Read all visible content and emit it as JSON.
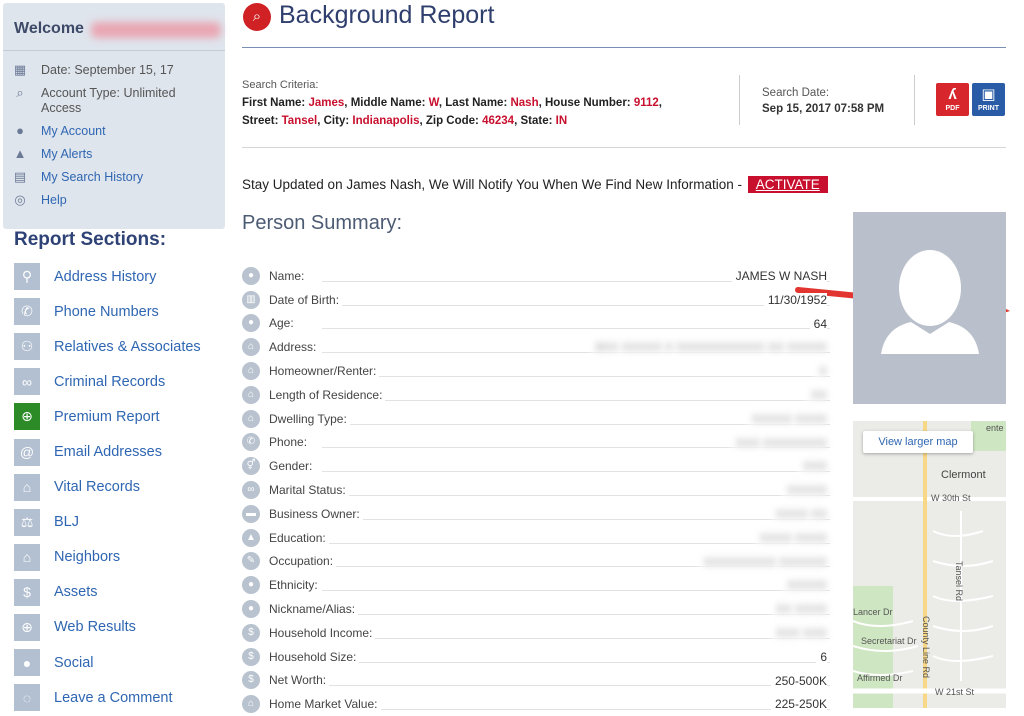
{
  "sidebar": {
    "welcome": "Welcome",
    "account": [
      {
        "icon": "calendar-icon",
        "glyph": "▦",
        "text": "Date: September 15, 17",
        "link": false
      },
      {
        "icon": "search-icon",
        "glyph": "⌕",
        "text": "Account Type: Unlimited Access",
        "link": false
      },
      {
        "icon": "user-icon",
        "glyph": "●",
        "text": "My Account",
        "link": true
      },
      {
        "icon": "alert-icon",
        "glyph": "▲",
        "text": "My Alerts",
        "link": true
      },
      {
        "icon": "history-icon",
        "glyph": "▤",
        "text": "My Search History",
        "link": true
      },
      {
        "icon": "help-icon",
        "glyph": "◎",
        "text": "Help",
        "link": true
      }
    ],
    "sections_title": "Report Sections:",
    "sections": [
      {
        "icon": "location-pin-icon",
        "glyph": "⚲",
        "label": "Address History"
      },
      {
        "icon": "phone-icon",
        "glyph": "✆",
        "label": "Phone Numbers"
      },
      {
        "icon": "people-icon",
        "glyph": "⚇",
        "label": "Relatives & Associates"
      },
      {
        "icon": "handcuffs-icon",
        "glyph": "∞",
        "label": "Criminal Records"
      },
      {
        "icon": "globe-icon",
        "glyph": "⊕",
        "label": "Premium Report",
        "green": true
      },
      {
        "icon": "at-icon",
        "glyph": "@",
        "label": "Email Addresses"
      },
      {
        "icon": "building-icon",
        "glyph": "⌂",
        "label": "Vital Records"
      },
      {
        "icon": "gavel-icon",
        "glyph": "⚖",
        "label": "BLJ"
      },
      {
        "icon": "houses-icon",
        "glyph": "⌂",
        "label": "Neighbors"
      },
      {
        "icon": "dollar-icon",
        "glyph": "$",
        "label": "Assets"
      },
      {
        "icon": "web-icon",
        "glyph": "⊕",
        "label": "Web Results"
      },
      {
        "icon": "person-icon",
        "glyph": "●",
        "label": "Social"
      },
      {
        "icon": "comment-icon",
        "glyph": "◌",
        "label": "Leave a Comment"
      }
    ]
  },
  "header": {
    "title": "Background Report",
    "criteria_label": "Search Criteria:",
    "criteria": {
      "first_name_label": "First Name:",
      "first_name": "James",
      "middle_name_label": "Middle Name:",
      "middle_name": "W",
      "last_name_label": "Last Name:",
      "last_name": "Nash",
      "house_number_label": "House Number:",
      "house_number": "9112",
      "street_label": "Street:",
      "street": "Tansel",
      "city_label": "City:",
      "city": "Indianapolis",
      "zip_label": "Zip Code:",
      "zip": "46234",
      "state_label": "State:",
      "state": "IN"
    },
    "search_date_label": "Search Date:",
    "search_date": "Sep 15, 2017 07:58 PM",
    "pdf_label": "PDF",
    "print_label": "PRINT"
  },
  "notify": {
    "text": "Stay Updated on James Nash, We Will Notify You When We Find New Information -",
    "button": "ACTIVATE"
  },
  "summary": {
    "title": "Person Summary:",
    "rows": [
      {
        "icon": "user-icon",
        "glyph": "●",
        "label": "Name:",
        "value": "JAMES W NASH",
        "blur": false
      },
      {
        "icon": "cake-icon",
        "glyph": "▥",
        "label": "Date of Birth:",
        "value": "11/30/1952",
        "blur": false
      },
      {
        "icon": "user-icon",
        "glyph": "●",
        "label": "Age:",
        "value": "64",
        "blur": false
      },
      {
        "icon": "home-icon",
        "glyph": "⌂",
        "label": "Address:",
        "value": "8XX XXXXX X XXXXXXXXXXX XX XXXXX",
        "blur": true
      },
      {
        "icon": "home-icon",
        "glyph": "⌂",
        "label": "Homeowner/Renter:",
        "value": "X",
        "blur": true
      },
      {
        "icon": "home-icon",
        "glyph": "⌂",
        "label": "Length of Residence:",
        "value": "XX",
        "blur": true
      },
      {
        "icon": "home-icon",
        "glyph": "⌂",
        "label": "Dwelling Type:",
        "value": "XXXXX XXXX",
        "blur": true
      },
      {
        "icon": "phone-icon",
        "glyph": "✆",
        "label": "Phone:",
        "value": "XXX XXXXXXXX",
        "blur": true
      },
      {
        "icon": "gender-icon",
        "glyph": "⚥",
        "label": "Gender:",
        "value": "XXX",
        "blur": true
      },
      {
        "icon": "rings-icon",
        "glyph": "∞",
        "label": "Marital Status:",
        "value": "XXXXX",
        "blur": true
      },
      {
        "icon": "briefcase-icon",
        "glyph": "▬",
        "label": "Business Owner:",
        "value": "XXXX XX",
        "blur": true
      },
      {
        "icon": "graduation-icon",
        "glyph": "▲",
        "label": "Education:",
        "value": "XXXX XXXX",
        "blur": true
      },
      {
        "icon": "pencil-icon",
        "glyph": "✎",
        "label": "Occupation:",
        "value": "XXXXXXXXX XXXXXX",
        "blur": true
      },
      {
        "icon": "user-icon",
        "glyph": "●",
        "label": "Ethnicity:",
        "value": "XXXXX",
        "blur": true
      },
      {
        "icon": "user-icon",
        "glyph": "●",
        "label": "Nickname/Alias:",
        "value": "XX XXXX",
        "blur": true
      },
      {
        "icon": "dollar-icon",
        "glyph": "$",
        "label": "Household Income:",
        "value": "XXX XXX",
        "blur": true
      },
      {
        "icon": "dollar-icon",
        "glyph": "$",
        "label": "Household Size:",
        "value": "6",
        "blur": false
      },
      {
        "icon": "money-bag-icon",
        "glyph": "$",
        "label": "Net Worth:",
        "value": "250-500K",
        "blur": false
      },
      {
        "icon": "home-icon",
        "glyph": "⌂",
        "label": "Home Market Value:",
        "value": "225-250K",
        "blur": false
      }
    ]
  },
  "map": {
    "larger_map": "View larger map",
    "labels": [
      "Clermont",
      "W 30th St",
      "Tansel Rd",
      "Lancer Dr",
      "Secretariat Dr",
      "County Line Rd",
      "Affirmed Dr",
      "W 21st St",
      "ente"
    ]
  },
  "colors": {
    "accent_red": "#c8102e",
    "link_blue": "#2f66b2",
    "title_navy": "#2f3f6d",
    "premium_green": "#2c8a27"
  }
}
